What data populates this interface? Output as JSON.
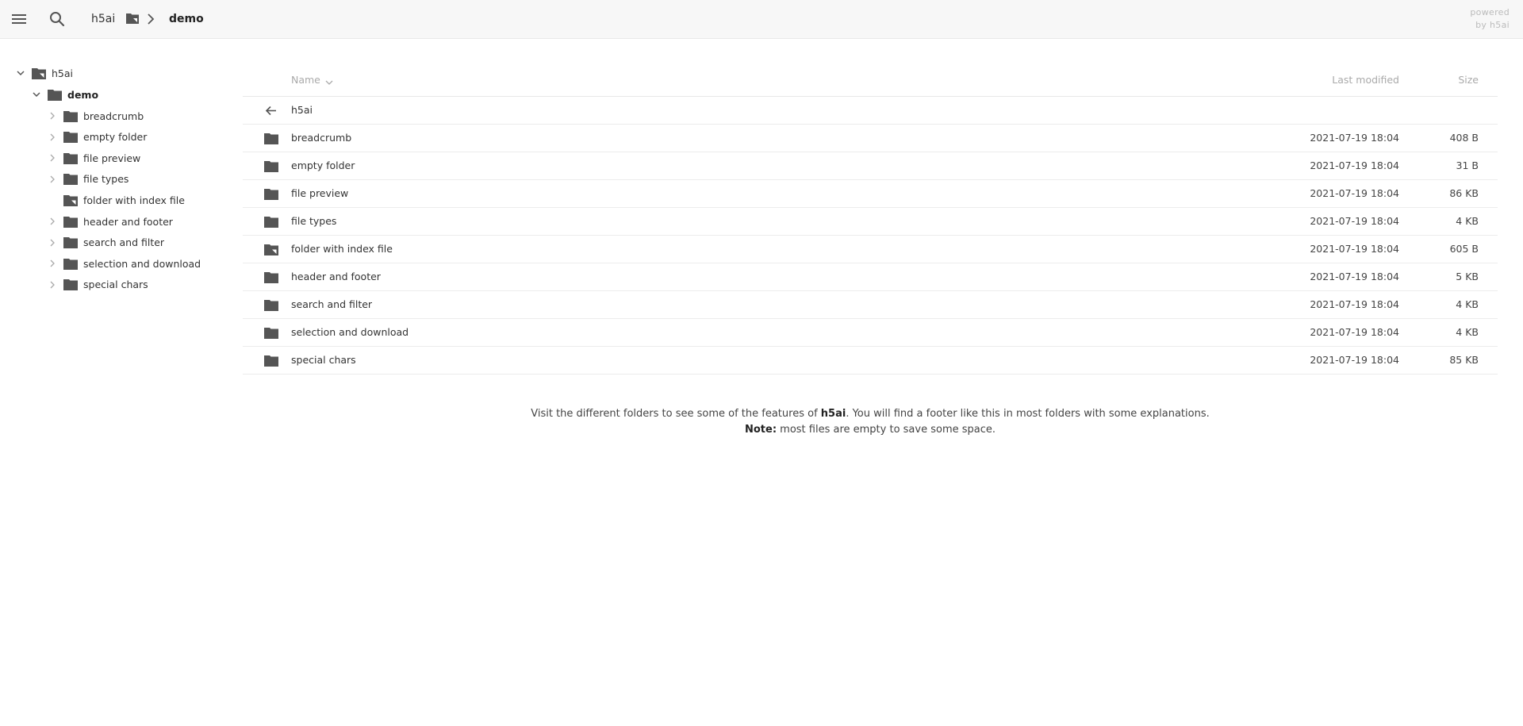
{
  "topbar": {
    "breadcrumb_root": "h5ai",
    "breadcrumb_current": "demo",
    "powered_line1": "powered",
    "powered_line2": "by h5ai"
  },
  "icons": {
    "menu": "menu-icon",
    "search": "search-icon",
    "folder": "folder-icon",
    "folder_page": "folder-page-icon",
    "back": "arrow-left-icon",
    "chevron_right": "chevron-right-icon",
    "chevron_down": "chevron-down-icon"
  },
  "colors": {
    "icon": "#555555",
    "topbar_bg": "#f7f7f7",
    "text": "#333333",
    "muted": "#aaaaaa"
  },
  "tree": {
    "root": {
      "label": "h5ai",
      "expanded": true
    },
    "current": {
      "label": "demo",
      "expanded": true
    },
    "children": [
      {
        "label": "breadcrumb",
        "has_children": true,
        "icon": "folder"
      },
      {
        "label": "empty folder",
        "has_children": true,
        "icon": "folder"
      },
      {
        "label": "file preview",
        "has_children": true,
        "icon": "folder"
      },
      {
        "label": "file types",
        "has_children": true,
        "icon": "folder"
      },
      {
        "label": "folder with index file",
        "has_children": false,
        "icon": "folder_page"
      },
      {
        "label": "header and footer",
        "has_children": true,
        "icon": "folder"
      },
      {
        "label": "search and filter",
        "has_children": true,
        "icon": "folder"
      },
      {
        "label": "selection and download",
        "has_children": true,
        "icon": "folder"
      },
      {
        "label": "special chars",
        "has_children": true,
        "icon": "folder"
      }
    ]
  },
  "listing": {
    "headers": {
      "name": "Name",
      "modified": "Last modified",
      "size": "Size"
    },
    "parent": {
      "label": "h5ai"
    },
    "rows": [
      {
        "name": "breadcrumb",
        "date": "2021-07-19 18:04",
        "size": "408 B",
        "icon": "folder"
      },
      {
        "name": "empty folder",
        "date": "2021-07-19 18:04",
        "size": "31 B",
        "icon": "folder"
      },
      {
        "name": "file preview",
        "date": "2021-07-19 18:04",
        "size": "86 KB",
        "icon": "folder"
      },
      {
        "name": "file types",
        "date": "2021-07-19 18:04",
        "size": "4 KB",
        "icon": "folder"
      },
      {
        "name": "folder with index file",
        "date": "2021-07-19 18:04",
        "size": "605 B",
        "icon": "folder_page"
      },
      {
        "name": "header and footer",
        "date": "2021-07-19 18:04",
        "size": "5 KB",
        "icon": "folder"
      },
      {
        "name": "search and filter",
        "date": "2021-07-19 18:04",
        "size": "4 KB",
        "icon": "folder"
      },
      {
        "name": "selection and download",
        "date": "2021-07-19 18:04",
        "size": "4 KB",
        "icon": "folder"
      },
      {
        "name": "special chars",
        "date": "2021-07-19 18:04",
        "size": "85 KB",
        "icon": "folder"
      }
    ]
  },
  "footer": {
    "line1_prefix": "Visit the different folders to see some of the features of ",
    "line1_brand": "h5ai",
    "line1_suffix": ". You will find a footer like this in most folders with some explanations.",
    "line2_bold": "Note:",
    "line2_text": " most files are empty to save some space."
  }
}
